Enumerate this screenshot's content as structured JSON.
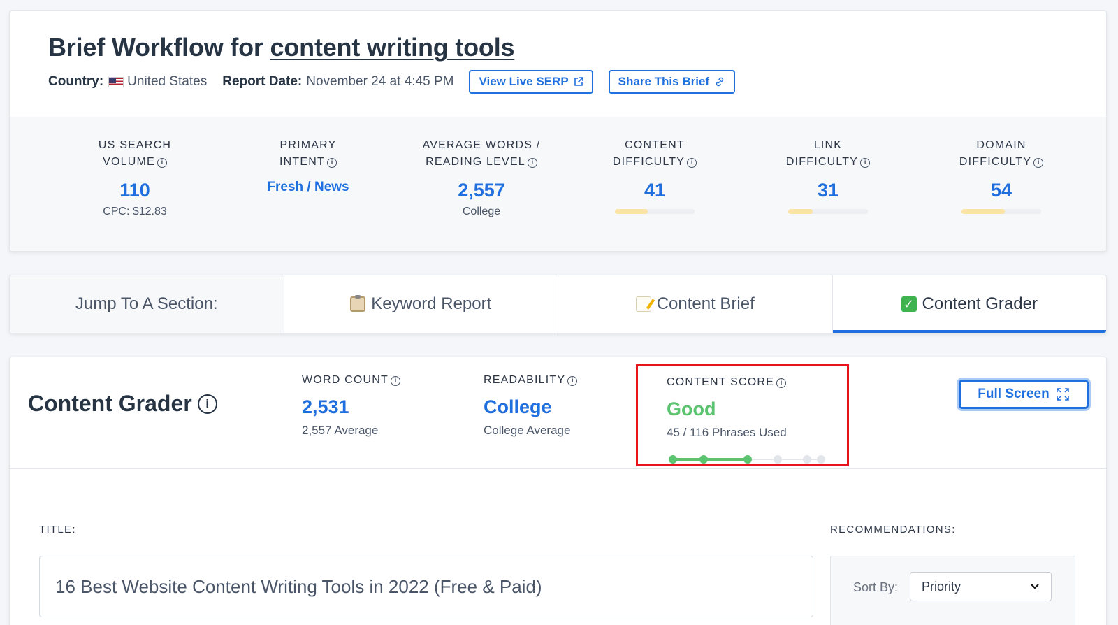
{
  "header": {
    "title_prefix": "Brief Workflow for ",
    "keyword": "content writing tools",
    "country_label": "Country:",
    "country_value": "United States",
    "report_date_label": "Report Date:",
    "report_date_value": "November 24 at 4:45 PM",
    "view_serp_label": "View Live SERP",
    "share_label": "Share This Brief"
  },
  "metrics": [
    {
      "label_line1": "US SEARCH",
      "label_line2": "VOLUME",
      "value": "110",
      "sub": "CPC: $12.83"
    },
    {
      "label_line1": "PRIMARY",
      "label_line2": "INTENT",
      "value": "Fresh / News",
      "sub": ""
    },
    {
      "label_line1": "AVERAGE WORDS /",
      "label_line2": "READING LEVEL",
      "value": "2,557",
      "sub": "College"
    },
    {
      "label_line1": "CONTENT",
      "label_line2": "DIFFICULTY",
      "value": "41",
      "level": 41
    },
    {
      "label_line1": "LINK",
      "label_line2": "DIFFICULTY",
      "value": "31",
      "level": 31
    },
    {
      "label_line1": "DOMAIN",
      "label_line2": "DIFFICULTY",
      "value": "54",
      "level": 54
    }
  ],
  "tabs": {
    "jump": "Jump To A Section:",
    "keyword_report": "Keyword Report",
    "content_brief": "Content Brief",
    "content_grader": "Content Grader"
  },
  "grader": {
    "title": "Content Grader",
    "word_count_label": "WORD COUNT",
    "word_count_value": "2,531",
    "word_count_sub": "2,557 Average",
    "readability_label": "READABILITY",
    "readability_value": "College",
    "readability_sub": "College Average",
    "score_label": "CONTENT SCORE",
    "score_value": "Good",
    "score_sub": "45 / 116 Phrases Used",
    "score_steps_total": 6,
    "score_steps_done": 3,
    "fullscreen_label": "Full Screen"
  },
  "editor": {
    "title_label": "TITLE:",
    "title_value": "16 Best Website Content Writing Tools in 2022 (Free & Paid)",
    "recommendations_label": "RECOMMENDATIONS:",
    "sort_label": "Sort By:",
    "sort_value": "Priority"
  },
  "colors": {
    "accent": "#1f6fde",
    "good": "#5cc36f",
    "highlight_box": "#e8141b",
    "difficulty_bar": "#fbe3a3"
  }
}
